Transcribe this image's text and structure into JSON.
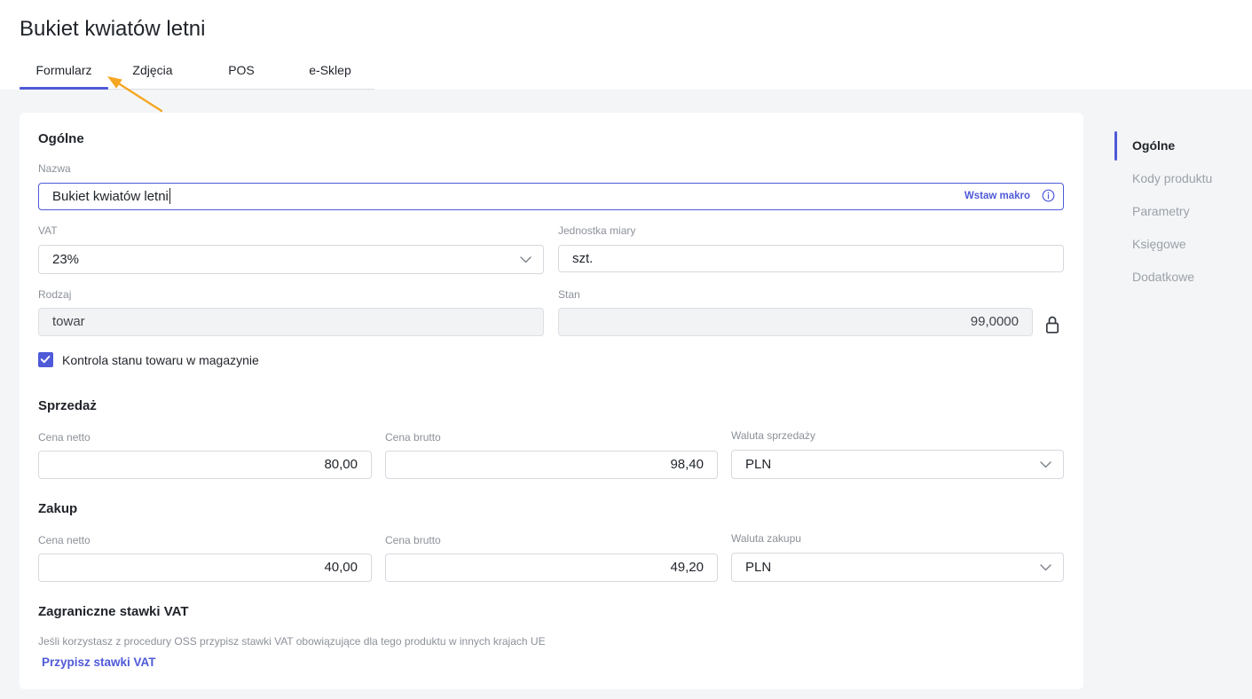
{
  "theme": {
    "accent": "#4e5ad8",
    "annotation": "#f5a623",
    "text": "#1f2329",
    "muted": "#8c9199",
    "page_bg": "#f4f5f7",
    "disabled_bg": "#f2f3f5"
  },
  "icons": {
    "name_info": "info-icon",
    "vat_dropdown": "chevron-down-icon",
    "stock_lock": "lock-icon",
    "stock_control_check": "check-icon",
    "sales_currency_dropdown": "chevron-down-icon",
    "purchase_currency_dropdown": "chevron-down-icon",
    "annotation": "arrow-annotation"
  },
  "header": {
    "title": "Bukiet kwiatów letni"
  },
  "tabs": [
    {
      "label": "Formularz",
      "active": true
    },
    {
      "label": "Zdjęcia",
      "active": false
    },
    {
      "label": "POS",
      "active": false
    },
    {
      "label": "e-Sklep",
      "active": false
    }
  ],
  "side_nav": [
    {
      "label": "Ogólne",
      "active": true
    },
    {
      "label": "Kody produktu",
      "active": false
    },
    {
      "label": "Parametry",
      "active": false
    },
    {
      "label": "Księgowe",
      "active": false
    },
    {
      "label": "Dodatkowe",
      "active": false
    }
  ],
  "general": {
    "title": "Ogólne",
    "name": {
      "label": "Nazwa",
      "value": "Bukiet kwiatów letni",
      "focused": true,
      "macro_label": "Wstaw makro"
    },
    "vat": {
      "label": "VAT",
      "value": "23%"
    },
    "unit": {
      "label": "Jednostka miary",
      "value": "szt."
    },
    "kind": {
      "label": "Rodzaj",
      "value": "towar",
      "disabled": true
    },
    "stock": {
      "label": "Stan",
      "value": "99,0000",
      "disabled": true,
      "locked": true
    },
    "stock_control": {
      "label": "Kontrola stanu towaru w magazynie",
      "checked": true
    }
  },
  "sales": {
    "title": "Sprzedaż",
    "net_price": {
      "label": "Cena netto",
      "value": "80,00"
    },
    "gross_price": {
      "label": "Cena brutto",
      "value": "98,40"
    },
    "currency": {
      "label": "Waluta sprzedaży",
      "value": "PLN"
    }
  },
  "purchase": {
    "title": "Zakup",
    "net_price": {
      "label": "Cena netto",
      "value": "40,00"
    },
    "gross_price": {
      "label": "Cena brutto",
      "value": "49,20"
    },
    "currency": {
      "label": "Waluta zakupu",
      "value": "PLN"
    }
  },
  "foreign_vat": {
    "title": "Zagraniczne stawki VAT",
    "description": "Jeśli korzystasz z procedury OSS przypisz stawki VAT obowiązujące dla tego produktu w innych krajach UE",
    "link_label": "Przypisz stawki VAT"
  }
}
